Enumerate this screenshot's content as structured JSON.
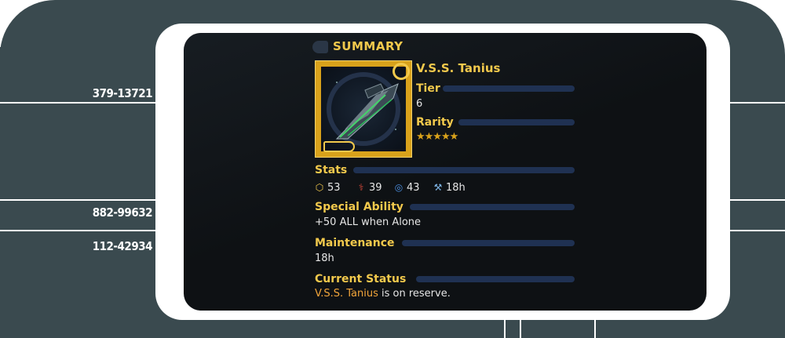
{
  "panel": {
    "coordinates": [
      "379-13721",
      "882-99632",
      "112-42934"
    ]
  },
  "summary": {
    "header": "SUMMARY",
    "ship_name": "V.S.S. Tanius",
    "tier_label": "Tier",
    "tier_value": "6",
    "rarity_label": "Rarity",
    "rarity_stars": "★★★★★",
    "stats_label": "Stats",
    "stats": [
      {
        "icon": "shield-stat-icon",
        "value": "53"
      },
      {
        "icon": "attack-stat-icon",
        "value": "39"
      },
      {
        "icon": "speed-stat-icon",
        "value": "43"
      },
      {
        "icon": "wrench-stat-icon",
        "value": "18h"
      }
    ],
    "special_label": "Special Ability",
    "special_value": "+50 ALL when Alone",
    "maintenance_label": "Maintenance",
    "maintenance_value": "18h",
    "status_label": "Current Status",
    "status_ship": "V.S.S. Tanius",
    "status_rest": " is on reserve."
  },
  "colors": {
    "accent_gold": "#f2c94c",
    "bar_blue": "#1f3152",
    "frame_gray": "#3a4a4f",
    "status_orange": "#f2a53a"
  }
}
